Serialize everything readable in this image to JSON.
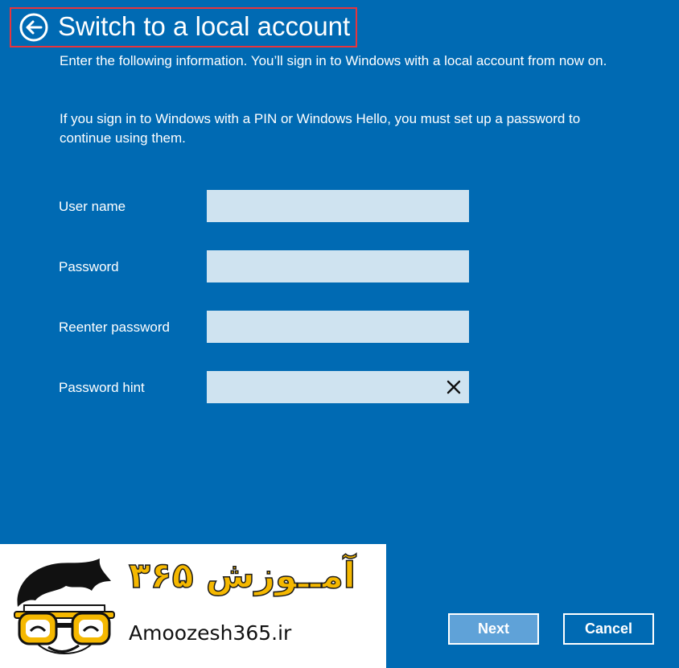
{
  "header": {
    "title": "Switch to a local account",
    "highlight_color": "#e8343c"
  },
  "instructions": {
    "line1": "Enter the following information. You’ll sign in to Windows with a local account from now on.",
    "line2": "If you sign in to Windows with a PIN or Windows Hello, you must set up a password to continue using them."
  },
  "form": {
    "username_label": "User name",
    "username_value": "",
    "password_label": "Password",
    "password_value": "",
    "reenter_label": "Reenter password",
    "reenter_value": "",
    "hint_label": "Password hint",
    "hint_value": ""
  },
  "buttons": {
    "next": "Next",
    "cancel": "Cancel"
  },
  "watermark": {
    "persian_text": "آمــوزش ۳۶۵",
    "url": "Amoozesh365.ir"
  },
  "colors": {
    "background": "#006ab3",
    "field": "#cfe3f0",
    "next_button": "#5fa2d8"
  }
}
